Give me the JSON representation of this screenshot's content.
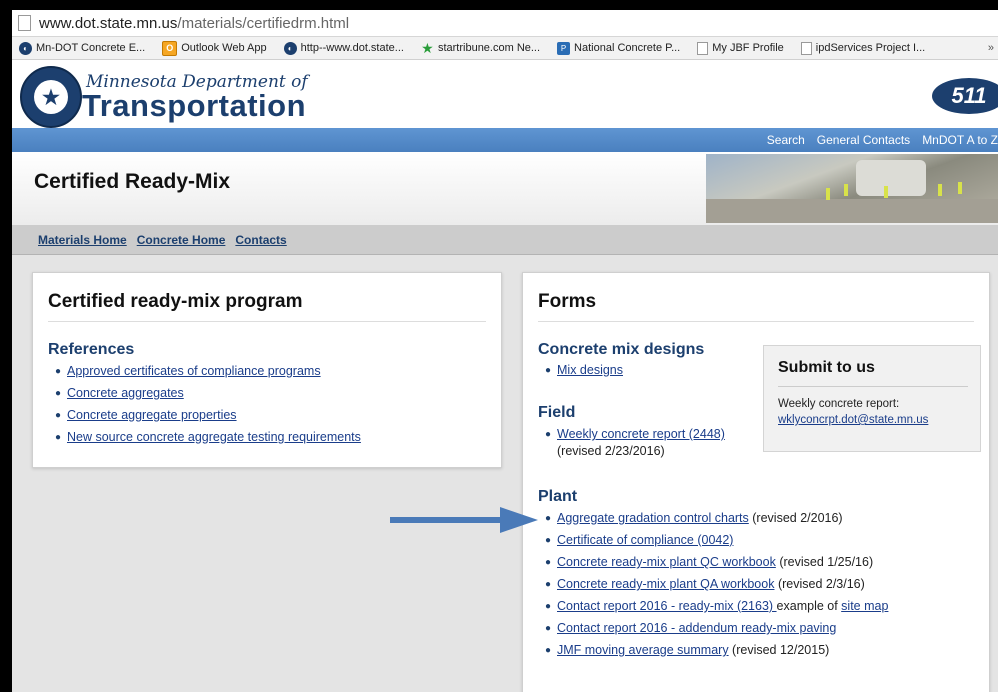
{
  "browser": {
    "url_domain": "www.dot.state.mn.us",
    "url_path": "/materials/certifiedrm.html",
    "bookmarks": [
      {
        "label": "Mn-DOT Concrete E...",
        "icon": "mndot-icon"
      },
      {
        "label": "Outlook Web App",
        "icon": "outlook-icon"
      },
      {
        "label": "http--www.dot.state...",
        "icon": "mndot-icon"
      },
      {
        "label": "startribune.com Ne...",
        "icon": "star-icon"
      },
      {
        "label": "National Concrete P...",
        "icon": "npca-icon"
      },
      {
        "label": "My JBF Profile",
        "icon": "page-icon"
      },
      {
        "label": "ipdServices Project I...",
        "icon": "page-icon"
      }
    ],
    "overflow": "»"
  },
  "header": {
    "agency_top": "Minnesota Department of",
    "agency_main": "Transportation",
    "logo_511": "511",
    "top_links": [
      "Search",
      "General Contacts",
      "MnDOT A to Z"
    ]
  },
  "page": {
    "title": "Certified Ready-Mix"
  },
  "breadcrumb": [
    "Materials Home",
    "Concrete Home",
    "Contacts"
  ],
  "left_panel": {
    "title": "Certified ready-mix program",
    "section": "References",
    "links": [
      "Approved certificates of compliance programs",
      "Concrete aggregates",
      "Concrete aggregate properties",
      "New source concrete aggregate testing requirements"
    ]
  },
  "right_panel": {
    "title": "Forms",
    "mix_section": "Concrete mix designs",
    "mix_link": "Mix designs",
    "field_section": "Field",
    "field_link": "Weekly concrete report (2448)",
    "field_note": "(revised 2/23/2016)",
    "plant_section": "Plant",
    "plant_items": [
      {
        "link": "Aggregate gradation control charts",
        "note": " (revised 2/2016)"
      },
      {
        "link": "Certificate of compliance (0042)",
        "note": ""
      },
      {
        "link": "Concrete ready-mix plant QC workbook",
        "note": " (revised 1/25/16)"
      },
      {
        "link": "Concrete ready-mix plant QA workbook",
        "note": " (revised 2/3/16)"
      },
      {
        "link": "Contact report 2016 - ready-mix (2163) ",
        "note": "example of ",
        "extra_link": "site map"
      },
      {
        "link": "Contact report 2016 - addendum ready-mix paving",
        "note": ""
      },
      {
        "link": "JMF moving average summary",
        "note": " (revised 12/2015)"
      }
    ],
    "submit": {
      "title": "Submit to us",
      "label": "Weekly concrete report:",
      "email": "wklyconcrpt.dot@state.mn.us"
    }
  },
  "colors": {
    "brand": "#1c3f6e",
    "nav_blue": "#4f86c6",
    "arrow": "#4a7ab8"
  }
}
